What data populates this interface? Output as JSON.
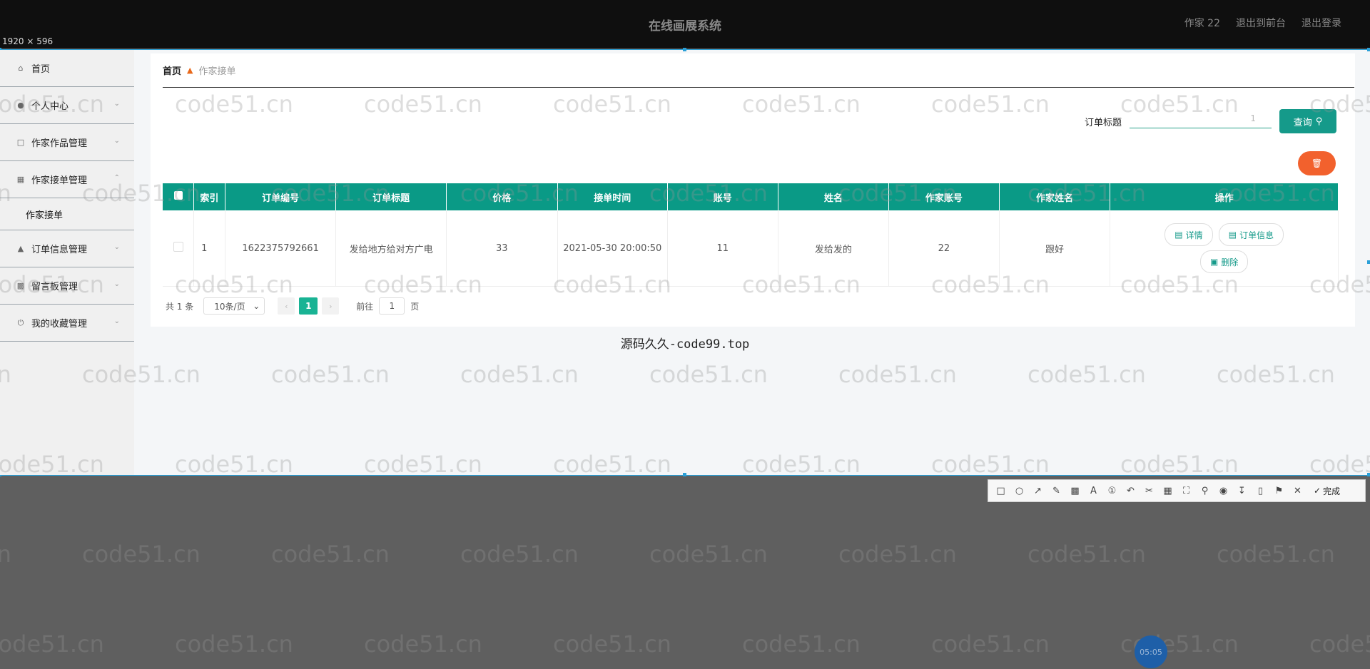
{
  "app": {
    "title": "在线画展系统",
    "user_label": "作家 22",
    "back_to_front": "退出到前台",
    "logout": "退出登录"
  },
  "capture_size_label": "1920 × 596",
  "sidebar": {
    "items": [
      {
        "label": "首页",
        "icon": "home-icon"
      },
      {
        "label": "个人中心",
        "icon": "user-icon"
      },
      {
        "label": "作家作品管理",
        "icon": "chat-icon"
      },
      {
        "label": "作家接单管理",
        "icon": "grid-icon"
      },
      {
        "label": "订单信息管理",
        "icon": "thumb-icon"
      },
      {
        "label": "留言板管理",
        "icon": "message-icon"
      },
      {
        "label": "我的收藏管理",
        "icon": "power-icon"
      }
    ],
    "submenu_item": "作家接单"
  },
  "breadcrumb": {
    "home": "首页",
    "current": "作家接单"
  },
  "search": {
    "label": "订单标题",
    "value": "1",
    "placeholder": "订单标题",
    "button": "查询"
  },
  "table": {
    "headers": [
      "索引",
      "订单编号",
      "订单标题",
      "价格",
      "接单时间",
      "账号",
      "姓名",
      "作家账号",
      "作家姓名",
      "操作"
    ],
    "rows": [
      {
        "index": "1",
        "order_no": "1622375792661",
        "title": "发给地方给对方广电",
        "price": "33",
        "time": "2021-05-30 20:00:50",
        "account": "11",
        "name": "发给发的",
        "writer_account": "22",
        "writer_name": "跟好"
      }
    ],
    "actions": {
      "detail": "详情",
      "order_info": "订单信息",
      "delete": "删除"
    }
  },
  "pager": {
    "total": "共 1 条",
    "page_size": "10条/页",
    "current_page": "1",
    "goto_prefix": "前往",
    "goto_value": "1",
    "goto_suffix": "页"
  },
  "overlay_text": "源码久久-code99.top",
  "watermark_text": "code51.cn",
  "screenshot_toolbar": {
    "done_label": "完成"
  },
  "clock": "05:05",
  "colors": {
    "accent": "#0a9a86",
    "danger": "#f2612d",
    "page_active": "#19b394",
    "breadcrumb_sep": "#e8681a"
  }
}
